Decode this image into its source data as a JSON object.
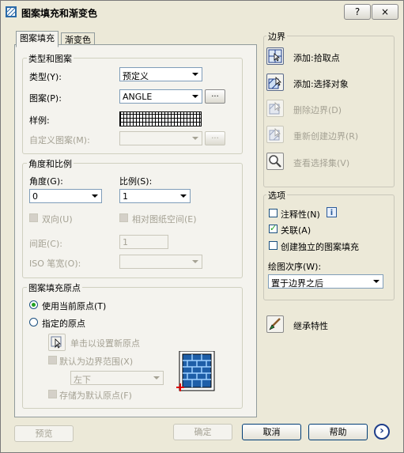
{
  "window": {
    "title": "图案填充和渐变色",
    "help_btn": "?",
    "close_btn": "×"
  },
  "tabs": [
    {
      "label": "图案填充"
    },
    {
      "label": "渐变色"
    }
  ],
  "type_pattern": {
    "group_label": "类型和图案",
    "type_label": "类型(Y):",
    "type_value": "预定义",
    "pattern_label": "图案(P):",
    "pattern_value": "ANGLE",
    "browse_label": "...",
    "sample_label": "样例:",
    "custom_label": "自定义图案(M):",
    "custom_value": ""
  },
  "angle_scale": {
    "group_label": "角度和比例",
    "angle_label": "角度(G):",
    "angle_value": "0",
    "scale_label": "比例(S):",
    "scale_value": "1",
    "double_label": "双向(U)",
    "relative_label": "相对图纸空间(E)",
    "spacing_label": "间距(C):",
    "spacing_value": "1",
    "iso_label": "ISO 笔宽(O):",
    "iso_value": ""
  },
  "origin": {
    "group_label": "图案填充原点",
    "use_current_label": "使用当前原点(T)",
    "specified_label": "指定的原点",
    "click_set_label": "单击以设置新原点",
    "default_extent_label": "默认为边界范围(X)",
    "extent_value": "左下",
    "store_default_label": "存储为默认原点(F)"
  },
  "boundary": {
    "group_label": "边界",
    "add_pick_label": "添加:拾取点",
    "add_select_label": "添加:选择对象",
    "remove_label": "删除边界(D)",
    "recreate_label": "重新创建边界(R)",
    "view_selection_label": "查看选择集(V)"
  },
  "options": {
    "group_label": "选项",
    "annotative_label": "注释性(N)",
    "info_icon": "i",
    "associative_label": "关联(A)",
    "separate_label": "创建独立的图案填充",
    "draw_order_label": "绘图次序(W):",
    "draw_order_value": "置于边界之后"
  },
  "inherit_label": "继承特性",
  "footer": {
    "preview": "预览",
    "ok": "确定",
    "cancel": "取消",
    "help": "帮助",
    "more": "›"
  }
}
